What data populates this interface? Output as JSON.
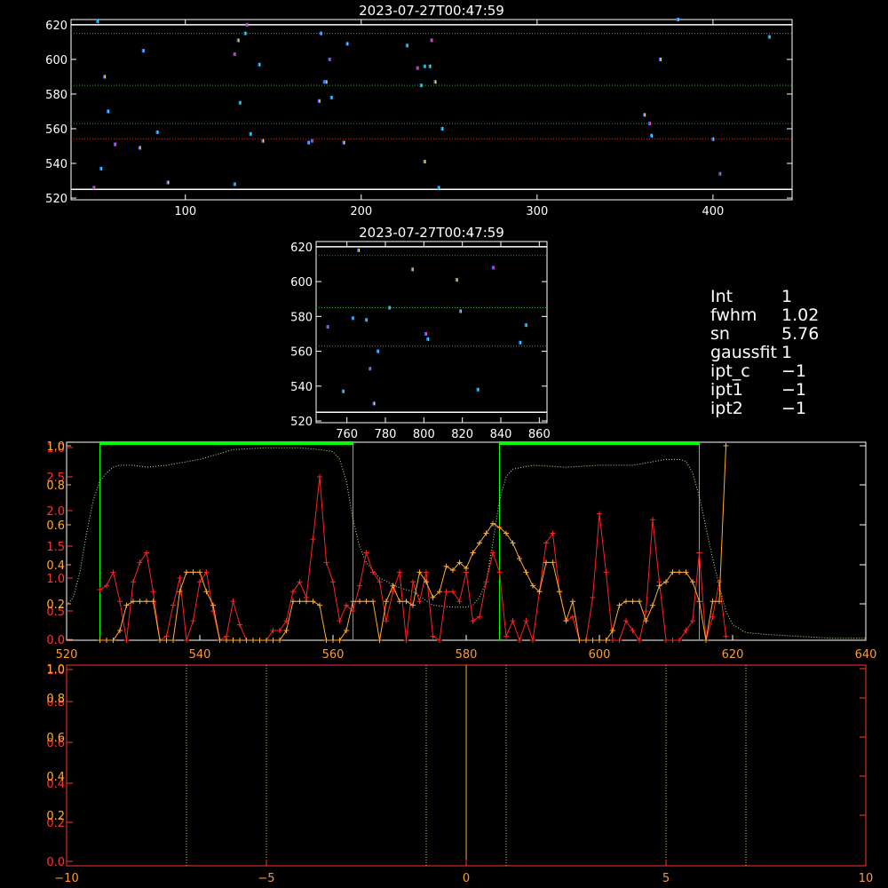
{
  "info": {
    "rows": [
      {
        "key": "Int",
        "value": "1"
      },
      {
        "key": "fwhm",
        "value": "1.02"
      },
      {
        "key": "sn",
        "value": "5.76"
      },
      {
        "key": "gaussfit",
        "value": "1"
      },
      {
        "key": "ipt_c",
        "value": "−1"
      },
      {
        "key": "ipt1",
        "value": "−1"
      },
      {
        "key": "ipt2",
        "value": "−1"
      }
    ]
  },
  "chart_data": [
    {
      "type": "scatter",
      "title": "2023-07-27T00:47:59",
      "xlim": [
        35,
        445
      ],
      "ylim": [
        519,
        623
      ],
      "xticks": [
        100,
        200,
        300,
        400
      ],
      "yticks": [
        520,
        540,
        560,
        580,
        600,
        620
      ],
      "hlines": [
        {
          "y": 620,
          "color": "#ffffff",
          "style": "solid"
        },
        {
          "y": 615,
          "color": "#22aa22",
          "style": "dotted"
        },
        {
          "y": 585,
          "color": "#22aa22",
          "style": "dotted"
        },
        {
          "y": 563,
          "color": "#22aa22",
          "style": "dotted"
        },
        {
          "y": 554,
          "color": "#cc2222",
          "style": "dotted"
        },
        {
          "y": 525,
          "color": "#ffffff",
          "style": "solid"
        }
      ],
      "points": [
        [
          48,
          526
        ],
        [
          50,
          622
        ],
        [
          52,
          537
        ],
        [
          54,
          590
        ],
        [
          56,
          570
        ],
        [
          60,
          551
        ],
        [
          74,
          549
        ],
        [
          76,
          605
        ],
        [
          84,
          558
        ],
        [
          90,
          529
        ],
        [
          128,
          603
        ],
        [
          128,
          528
        ],
        [
          130,
          611
        ],
        [
          131,
          575
        ],
        [
          134,
          615
        ],
        [
          135,
          620
        ],
        [
          137,
          557
        ],
        [
          142,
          597
        ],
        [
          144,
          553
        ],
        [
          170,
          552
        ],
        [
          172,
          553
        ],
        [
          176,
          576
        ],
        [
          177,
          615
        ],
        [
          179,
          587
        ],
        [
          180,
          587
        ],
        [
          182,
          600
        ],
        [
          183,
          578
        ],
        [
          190,
          552
        ],
        [
          192,
          609
        ],
        [
          226,
          608
        ],
        [
          232,
          595
        ],
        [
          234,
          585
        ],
        [
          236,
          596
        ],
        [
          236,
          541
        ],
        [
          239,
          596
        ],
        [
          240,
          611
        ],
        [
          242,
          587
        ],
        [
          244,
          526
        ],
        [
          246,
          560
        ],
        [
          361,
          568
        ],
        [
          364,
          563
        ],
        [
          365,
          556
        ],
        [
          370,
          600
        ],
        [
          380,
          623
        ],
        [
          400,
          554
        ],
        [
          404,
          534
        ],
        [
          432,
          613
        ]
      ]
    },
    {
      "type": "scatter",
      "title": "2023-07-27T00:47:59",
      "xlim": [
        744,
        864
      ],
      "ylim": [
        519,
        623
      ],
      "xticks": [
        760,
        780,
        800,
        820,
        840,
        860
      ],
      "yticks": [
        520,
        540,
        560,
        580,
        600,
        620
      ],
      "hlines": [
        {
          "y": 620,
          "color": "#ffffff",
          "style": "solid"
        },
        {
          "y": 615,
          "color": "#22aa22",
          "style": "dotted"
        },
        {
          "y": 585,
          "color": "#22aa22",
          "style": "dotted"
        },
        {
          "y": 563,
          "color": "#22aa22",
          "style": "dotted"
        },
        {
          "y": 525,
          "color": "#ffffff",
          "style": "solid"
        }
      ],
      "points": [
        [
          750,
          574
        ],
        [
          758,
          537
        ],
        [
          763,
          579
        ],
        [
          766,
          618
        ],
        [
          770,
          578
        ],
        [
          772,
          550
        ],
        [
          774,
          530
        ],
        [
          776,
          560
        ],
        [
          782,
          585
        ],
        [
          794,
          607
        ],
        [
          801,
          570
        ],
        [
          802,
          567
        ],
        [
          817,
          601
        ],
        [
          819,
          583
        ],
        [
          828,
          538
        ],
        [
          836,
          608
        ],
        [
          850,
          565
        ],
        [
          853,
          575
        ]
      ]
    },
    {
      "type": "line",
      "xlim": [
        520,
        640
      ],
      "xticks": [
        520,
        540,
        560,
        580,
        600,
        620,
        640
      ],
      "left_axis_primary": [
        "0.0",
        "0.5",
        "1.0",
        "1.5",
        "2.0",
        "2.5",
        "1.0"
      ],
      "left_axis_secondary": [
        "0.2",
        "0.4",
        "0.6",
        "0.8",
        "1.0"
      ],
      "bands": [
        {
          "from": 525,
          "to": 563,
          "color": "#00ff00"
        },
        {
          "from": 585,
          "to": 615,
          "color": "#00ff00"
        }
      ],
      "series": [
        {
          "style": "dotted",
          "color": "#bbee99",
          "x": [
            520,
            521,
            522,
            523,
            524,
            525,
            526,
            527,
            528,
            530,
            532,
            535,
            540,
            545,
            550,
            555,
            558,
            560,
            561,
            562,
            563,
            564,
            565,
            567,
            570,
            572,
            575,
            578,
            580,
            581,
            582,
            583,
            584,
            585,
            586,
            587,
            590,
            595,
            600,
            605,
            610,
            612,
            613,
            614,
            615,
            616,
            617,
            618,
            619,
            620,
            622,
            625,
            630,
            635,
            640
          ],
          "y": [
            0.18,
            0.22,
            0.35,
            0.55,
            0.72,
            0.82,
            0.86,
            0.89,
            0.9,
            0.9,
            0.89,
            0.9,
            0.93,
            0.98,
            0.99,
            0.99,
            0.98,
            0.97,
            0.93,
            0.82,
            0.62,
            0.48,
            0.4,
            0.32,
            0.27,
            0.25,
            0.18,
            0.17,
            0.17,
            0.18,
            0.22,
            0.3,
            0.5,
            0.72,
            0.84,
            0.88,
            0.9,
            0.89,
            0.9,
            0.9,
            0.93,
            0.93,
            0.92,
            0.86,
            0.74,
            0.58,
            0.42,
            0.28,
            0.15,
            0.08,
            0.04,
            0.03,
            0.02,
            0.01,
            0.01
          ]
        },
        {
          "style": "plus",
          "color": "#ff2222",
          "x": [
            525,
            526,
            527,
            528,
            529,
            530,
            531,
            532,
            533,
            534,
            535,
            536,
            537,
            538,
            539,
            540,
            541,
            542,
            543,
            544,
            545,
            546,
            547,
            548,
            549,
            550,
            551,
            552,
            553,
            554,
            555,
            556,
            557,
            558,
            559,
            560,
            561,
            562,
            563,
            564,
            565,
            566,
            567,
            568,
            569,
            570,
            571,
            572,
            573,
            574,
            575,
            576,
            577,
            578,
            579,
            580,
            581,
            582,
            583,
            584,
            585,
            586,
            587,
            588,
            589,
            590,
            591,
            592,
            593,
            594,
            595,
            596,
            597,
            598,
            599,
            600,
            601,
            602,
            603,
            604,
            605,
            606,
            607,
            608,
            609,
            610,
            611,
            612,
            613,
            614,
            615,
            616,
            617,
            618,
            619
          ],
          "y": [
            0.26,
            0.28,
            0.35,
            0.2,
            0.0,
            0.3,
            0.4,
            0.45,
            0.25,
            0.0,
            0.02,
            0.18,
            0.32,
            0.0,
            0.1,
            0.3,
            0.35,
            0.15,
            0.0,
            0.02,
            0.2,
            0.08,
            0.0,
            0.0,
            0.0,
            0.0,
            0.05,
            0.05,
            0.1,
            0.25,
            0.3,
            0.22,
            0.52,
            0.84,
            0.4,
            0.3,
            0.1,
            0.18,
            0.15,
            0.28,
            0.45,
            0.35,
            0.3,
            0.1,
            0.25,
            0.35,
            0.0,
            0.3,
            0.2,
            0.35,
            0.02,
            0.0,
            0.25,
            0.25,
            0.2,
            0.35,
            0.1,
            0.12,
            0.3,
            0.45,
            0.35,
            0.02,
            0.1,
            0.0,
            0.1,
            0.0,
            0.25,
            0.5,
            0.55,
            0.25,
            0.1,
            0.12,
            0.0,
            0.0,
            0.22,
            0.65,
            0.35,
            0.0,
            0.0,
            0.1,
            0.05,
            0.0,
            0.15,
            0.62,
            0.3,
            0.0,
            0.0,
            0.0,
            0.05,
            0.1,
            0.45,
            0.0,
            0.12,
            0.3,
            0.02
          ]
        },
        {
          "style": "plus",
          "color": "#ffaa33",
          "x": [
            525,
            526,
            527,
            528,
            529,
            530,
            531,
            532,
            533,
            534,
            535,
            536,
            537,
            538,
            539,
            540,
            541,
            542,
            543,
            544,
            545,
            546,
            547,
            548,
            549,
            550,
            551,
            552,
            553,
            554,
            555,
            556,
            557,
            558,
            559,
            560,
            561,
            562,
            563,
            564,
            565,
            566,
            567,
            568,
            569,
            570,
            571,
            572,
            573,
            574,
            575,
            576,
            577,
            578,
            579,
            580,
            581,
            582,
            583,
            584,
            585,
            586,
            587,
            588,
            589,
            590,
            591,
            592,
            593,
            594,
            595,
            596,
            597,
            598,
            599,
            600,
            601,
            602,
            603,
            604,
            605,
            606,
            607,
            608,
            609,
            610,
            611,
            612,
            613,
            614,
            615,
            616,
            617,
            618,
            619
          ],
          "y": [
            0.0,
            0.0,
            0.0,
            0.05,
            0.18,
            0.2,
            0.2,
            0.2,
            0.2,
            0.0,
            0.0,
            0.0,
            0.25,
            0.35,
            0.35,
            0.35,
            0.25,
            0.18,
            0.0,
            0.0,
            0.0,
            0.0,
            0.0,
            0.0,
            0.0,
            0.0,
            0.0,
            0.0,
            0.05,
            0.2,
            0.2,
            0.2,
            0.2,
            0.18,
            0.0,
            0.0,
            0.0,
            0.05,
            0.2,
            0.2,
            0.2,
            0.2,
            0.0,
            0.2,
            0.28,
            0.2,
            0.2,
            0.18,
            0.35,
            0.3,
            0.22,
            0.25,
            0.38,
            0.36,
            0.4,
            0.37,
            0.45,
            0.5,
            0.55,
            0.6,
            0.58,
            0.55,
            0.5,
            0.42,
            0.35,
            0.28,
            0.25,
            0.4,
            0.4,
            0.25,
            0.1,
            0.2,
            0.0,
            0.0,
            0.0,
            0.0,
            0.0,
            0.05,
            0.18,
            0.2,
            0.2,
            0.2,
            0.1,
            0.18,
            0.28,
            0.3,
            0.35,
            0.35,
            0.35,
            0.3,
            0.2,
            0.0,
            0.2,
            0.2,
            1.0
          ]
        }
      ]
    },
    {
      "type": "line",
      "xlim": [
        -10,
        10
      ],
      "xticks": [
        -10,
        -5,
        0,
        5,
        10
      ],
      "left_axis_primary": [
        "0.0",
        "0.2",
        "0.4",
        "0.6",
        "0.8",
        "1.0"
      ],
      "left_axis_secondary": [
        "0.2",
        "0.4",
        "0.6",
        "0.8",
        "1.0"
      ],
      "vlines": [
        {
          "x": -7,
          "color": "#cccc66",
          "style": "dotted"
        },
        {
          "x": -5,
          "color": "#cccc66",
          "style": "dotted"
        },
        {
          "x": -1,
          "color": "#cccc66",
          "style": "dotted"
        },
        {
          "x": 1,
          "color": "#cccc66",
          "style": "dotted"
        },
        {
          "x": 5,
          "color": "#cccc66",
          "style": "dotted"
        },
        {
          "x": 7,
          "color": "#cccc66",
          "style": "dotted"
        },
        {
          "x": 0,
          "color": "#ffaa33",
          "style": "solid"
        }
      ]
    }
  ]
}
